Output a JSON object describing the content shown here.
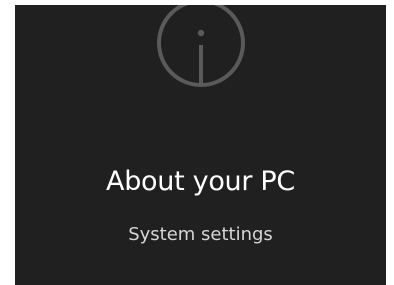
{
  "tile": {
    "icon": "info-icon",
    "title": "About your PC",
    "subtitle": "System settings",
    "background_color": "#202020",
    "icon_color": "#5a5a5a"
  }
}
